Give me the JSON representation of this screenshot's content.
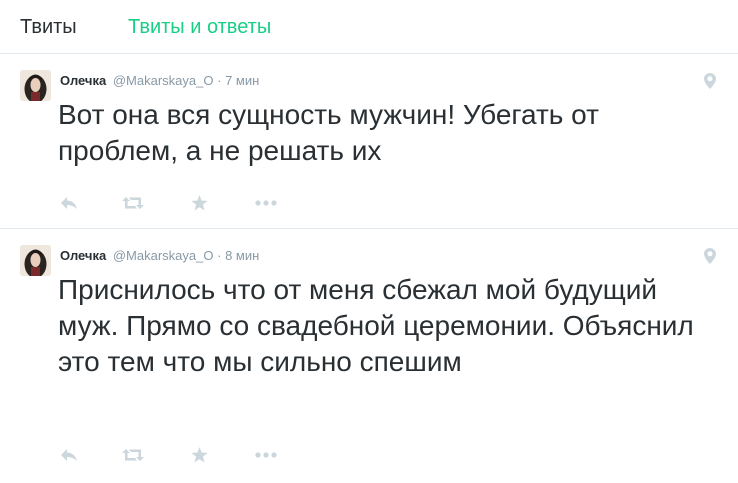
{
  "tabs": {
    "tweets_label": "Твиты",
    "replies_label": "Твиты и ответы",
    "active": "Твиты и ответы",
    "active_color": "#19cf86"
  },
  "tweets": [
    {
      "name": "Олечка",
      "handle": "@Makarskaya_O",
      "separator": "·",
      "time": "7 мин",
      "text": "Вот она вся сущность мужчин! Убегать от проблем, а не решать их",
      "icons": [
        "reply-icon",
        "retweet-icon",
        "favorite-icon",
        "more-icon",
        "location-pin-icon"
      ]
    },
    {
      "name": "Олечка",
      "handle": "@Makarskaya_O",
      "separator": "·",
      "time": "8 мин",
      "text": "Приснилось что от меня сбежал мой будущий муж. Прямо со свадебной церемонии. Объяснил это тем что мы сильно спешим",
      "icons": [
        "reply-icon",
        "retweet-icon",
        "favorite-icon",
        "more-icon",
        "location-pin-icon"
      ]
    }
  ],
  "colors": {
    "text": "#292f33",
    "meta": "#8899a6",
    "icon": "#ccd6dd",
    "divider": "#e1e8ed"
  }
}
